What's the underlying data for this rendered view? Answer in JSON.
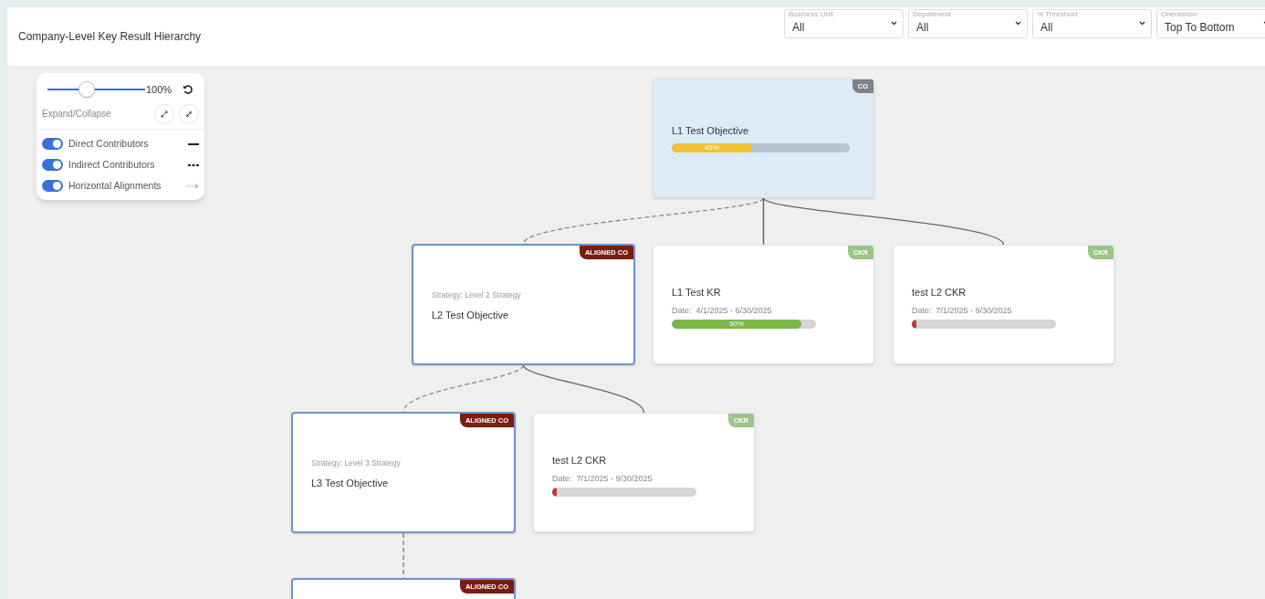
{
  "header": {
    "title": "Company-Level Key Result Hierarchy"
  },
  "filters": [
    {
      "label": "Business Unit",
      "value": "All"
    },
    {
      "label": "Department",
      "value": "All"
    },
    {
      "label": "% Threshold",
      "value": "All"
    },
    {
      "label": "Orientation",
      "value": "Top To Bottom"
    }
  ],
  "controls": {
    "zoom": {
      "level": 0.4,
      "reading": "100%"
    },
    "expand_label": "Expand/Collapse",
    "toggles": [
      {
        "label": "Direct Contributors",
        "on": true,
        "kind": "solid"
      },
      {
        "label": "Indirect Contributors",
        "on": true,
        "kind": "dashed"
      },
      {
        "label": "Horizontal Alignments",
        "on": true,
        "kind": "arrow"
      }
    ]
  },
  "tree": {
    "kind": "co",
    "badge": "CO",
    "title": "L1 Test Objective",
    "progress": {
      "level": 0.45,
      "label": "45%",
      "color": "#f2c037"
    },
    "children": [
      {
        "kind": "aligned",
        "indirect": true,
        "badge": "ALIGNED CO",
        "strategy": "Strategy: Level 2 Strategy",
        "title": "L2 Test Objective",
        "children": [
          {
            "kind": "aligned",
            "indirect": true,
            "badge": "ALIGNED CO",
            "strategy": "Strategy: Level 3 Strategy",
            "title": "L3 Test Objective",
            "children": [
              {
                "kind": "aligned",
                "indirect": true,
                "badge": "ALIGNED CO"
              }
            ]
          },
          {
            "kind": "ckr",
            "indirect": false,
            "badge": "CKR",
            "title": "test L2 CKR",
            "date": "Date:  7/1/2025 - 9/30/2025",
            "progress": {
              "level": 0.03,
              "color": "#c0392b"
            }
          }
        ]
      },
      {
        "kind": "ckr",
        "indirect": false,
        "badge": "CKR",
        "title": "L1 Test KR",
        "date": "Date:  4/1/2025 - 6/30/2025",
        "progress": {
          "level": 0.9,
          "label": "90%",
          "color": "#7ab648"
        }
      },
      {
        "kind": "ckr",
        "indirect": false,
        "badge": "CKR",
        "title": "test L2 CKR",
        "date": "Date:  7/1/2025 - 9/30/2025",
        "progress": {
          "level": 0.03,
          "color": "#c0392b"
        }
      }
    ]
  }
}
